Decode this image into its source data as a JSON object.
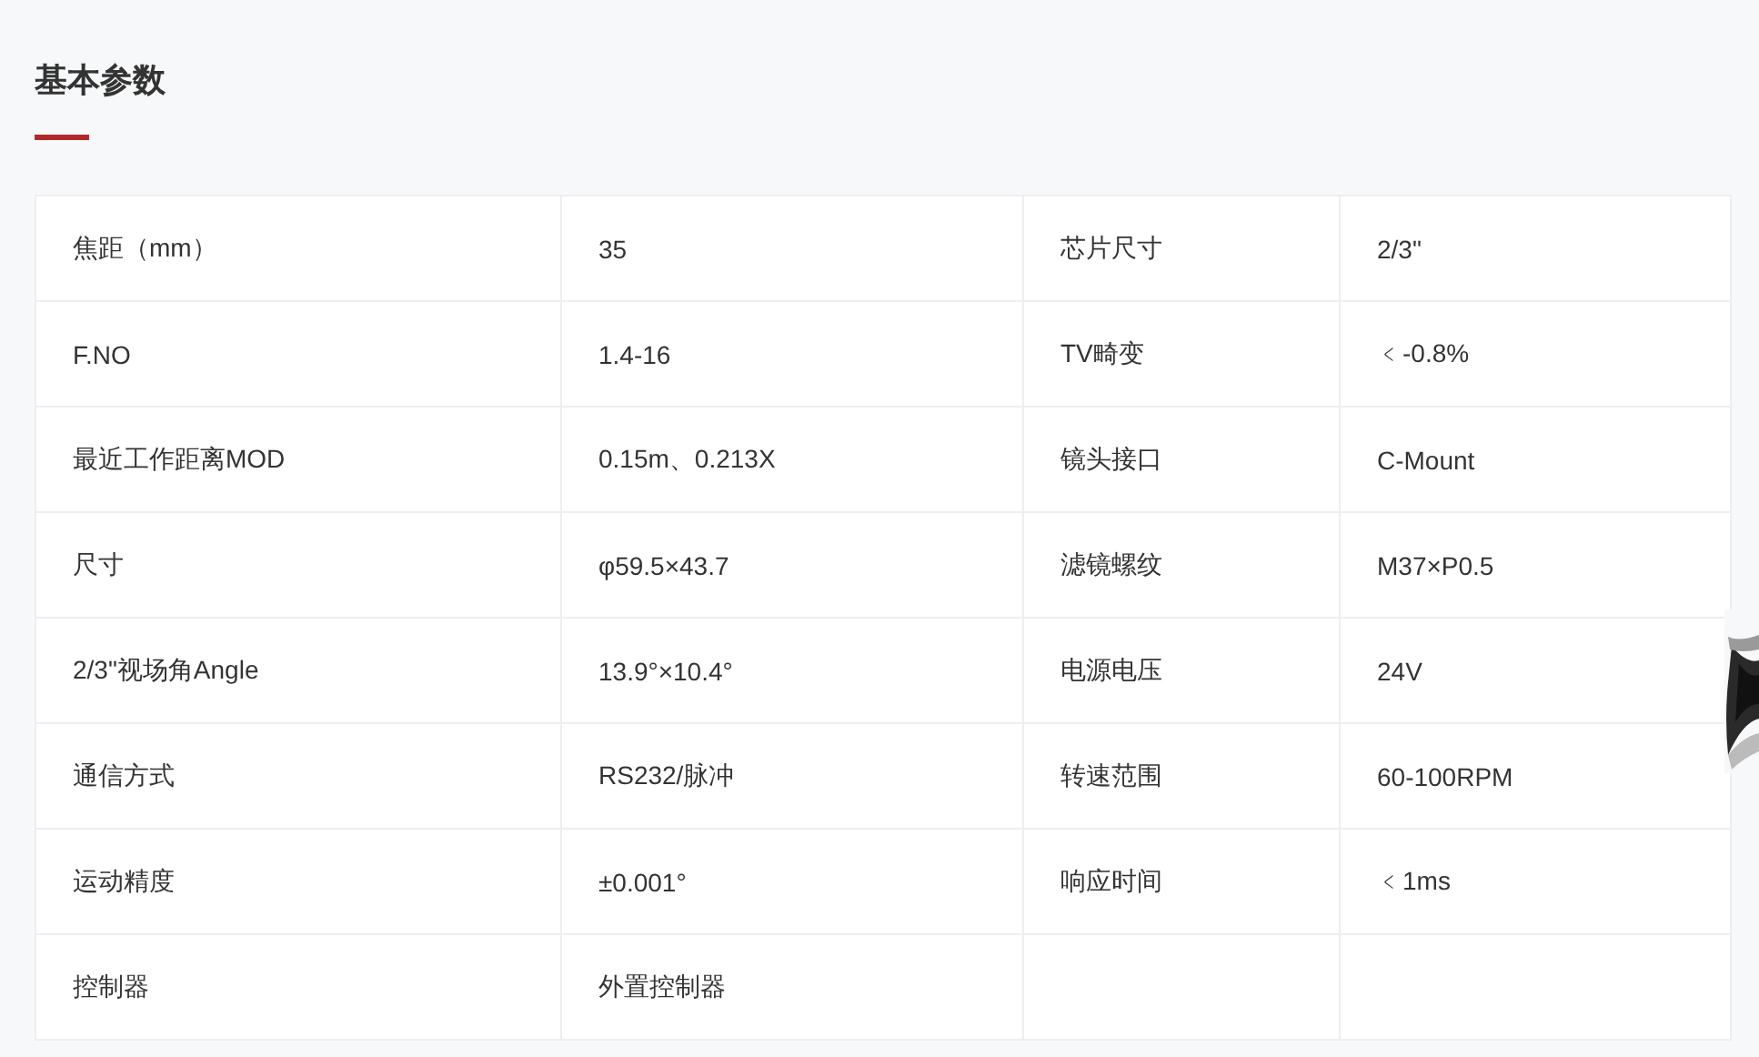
{
  "section": {
    "title": "基本参数"
  },
  "table": {
    "rows": [
      [
        "焦距（mm）",
        "35",
        "芯片尺寸",
        "2/3\""
      ],
      [
        "F.NO",
        "1.4-16",
        "TV畸变",
        "﹤-0.8%"
      ],
      [
        "最近工作距离MOD",
        "0.15m、0.213X",
        "镜头接口",
        "C-Mount"
      ],
      [
        "尺寸",
        "φ59.5×43.7",
        "滤镜螺纹",
        "M37×P0.5"
      ],
      [
        "2/3\"视场角Angle",
        "13.9°×10.4°",
        "电源电压",
        "24V"
      ],
      [
        "通信方式",
        "RS232/脉冲",
        "转速范围",
        "60-100RPM"
      ],
      [
        "运动精度",
        "±0.001°",
        "响应时间",
        "﹤1ms"
      ],
      [
        "控制器",
        "外置控制器"
      ]
    ]
  }
}
